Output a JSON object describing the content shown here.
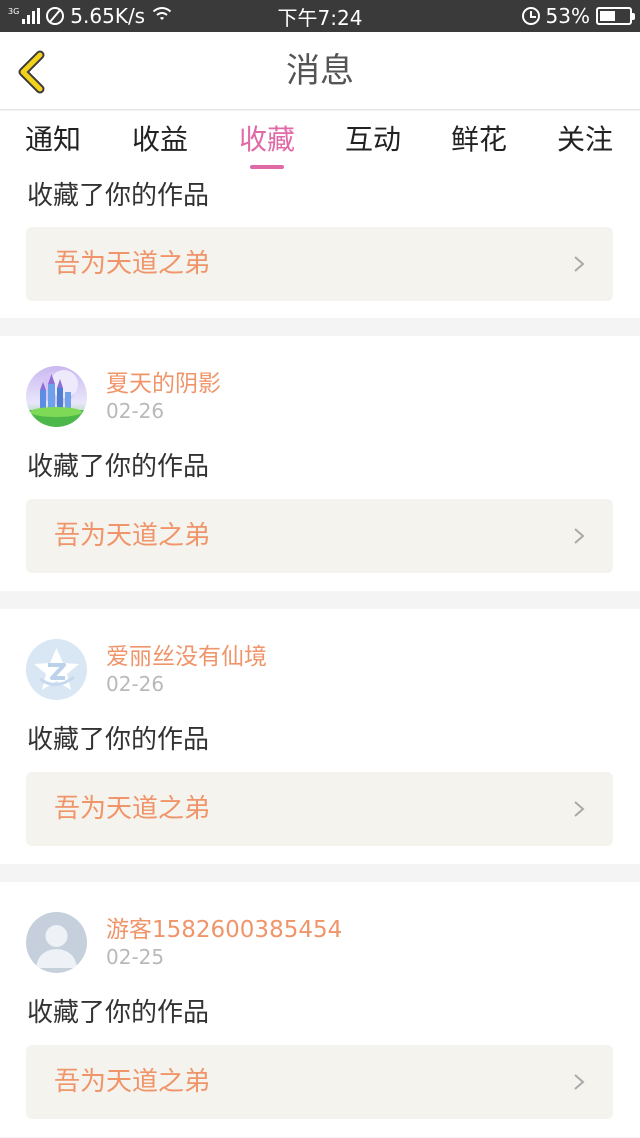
{
  "status_bar": {
    "network_type": "3G",
    "speed": "5.65K/s",
    "time": "下午7:24",
    "battery": "53%",
    "battery_level": 0.53,
    "icons": [
      "signal-icon",
      "no-sim-icon",
      "wifi-icon",
      "alarm-icon",
      "battery-icon"
    ]
  },
  "header": {
    "title": "消息",
    "back_icon": "chevron-left-icon",
    "accent_color": "#f2d21b"
  },
  "tabs": [
    {
      "label": "通知"
    },
    {
      "label": "收益"
    },
    {
      "label": "收藏"
    },
    {
      "label": "互动"
    },
    {
      "label": "鲜花"
    },
    {
      "label": "关注"
    }
  ],
  "active_tab": "收藏",
  "colors": {
    "active_tab": "#e06aa6",
    "username": "#f0956a",
    "work_title": "#f0956a",
    "date": "#b9b9b9"
  },
  "feed": {
    "first_partial": {
      "action": "收藏了你的作品",
      "work_title": "吾为天道之弟"
    },
    "items": [
      {
        "username": "夏天的阴影",
        "date": "02-26",
        "action": "收藏了你的作品",
        "work_title": "吾为天道之弟",
        "avatar": "castle-avatar"
      },
      {
        "username": "爱丽丝没有仙境",
        "date": "02-26",
        "action": "收藏了你的作品",
        "work_title": "吾为天道之弟",
        "avatar": "qzone-star-avatar"
      },
      {
        "username": "游客1582600385454",
        "date": "02-25",
        "action": "收藏了你的作品",
        "work_title": "吾为天道之弟",
        "avatar": "default-person-avatar"
      }
    ]
  }
}
